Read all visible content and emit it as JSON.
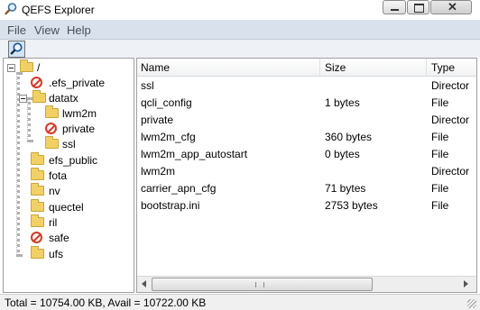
{
  "window": {
    "title": "QEFS Explorer",
    "close_glyph": "✕"
  },
  "menu": {
    "file": "File",
    "view": "View",
    "help": "Help"
  },
  "toolbar": {
    "search_icon": "magnifier-icon"
  },
  "tree": {
    "root": "/",
    "items": [
      {
        "label": ".efs_private",
        "icon": "no-entry-icon"
      },
      {
        "label": "datatx",
        "icon": "folder-open-icon"
      },
      {
        "label": "lwm2m",
        "icon": "folder-icon"
      },
      {
        "label": "private",
        "icon": "no-entry-icon"
      },
      {
        "label": "ssl",
        "icon": "folder-icon"
      },
      {
        "label": "efs_public",
        "icon": "folder-icon"
      },
      {
        "label": "fota",
        "icon": "folder-icon"
      },
      {
        "label": "nv",
        "icon": "folder-icon"
      },
      {
        "label": "quectel",
        "icon": "folder-icon"
      },
      {
        "label": "ril",
        "icon": "folder-icon"
      },
      {
        "label": "safe",
        "icon": "no-entry-icon"
      },
      {
        "label": "ufs",
        "icon": "folder-icon"
      }
    ]
  },
  "list": {
    "columns": {
      "name": "Name",
      "size": "Size",
      "type": "Type"
    },
    "rows": [
      {
        "name": "ssl",
        "size": "",
        "type": "Director"
      },
      {
        "name": "qcli_config",
        "size": "1 bytes",
        "type": "File"
      },
      {
        "name": "private",
        "size": "",
        "type": "Director"
      },
      {
        "name": "lwm2m_cfg",
        "size": "360 bytes",
        "type": "File"
      },
      {
        "name": "lwm2m_app_autostart",
        "size": "0 bytes",
        "type": "File"
      },
      {
        "name": "lwm2m",
        "size": "",
        "type": "Director"
      },
      {
        "name": "carrier_apn_cfg",
        "size": "71 bytes",
        "type": "File"
      },
      {
        "name": "bootstrap.ini",
        "size": "2753 bytes",
        "type": "File"
      }
    ]
  },
  "status": {
    "text": "Total = 10754.00 KB, Avail = 10722.00 KB"
  },
  "colors": {
    "menubar": "#d9e1ec",
    "folder": "#f1d166",
    "no_entry": "#d43b2a"
  }
}
